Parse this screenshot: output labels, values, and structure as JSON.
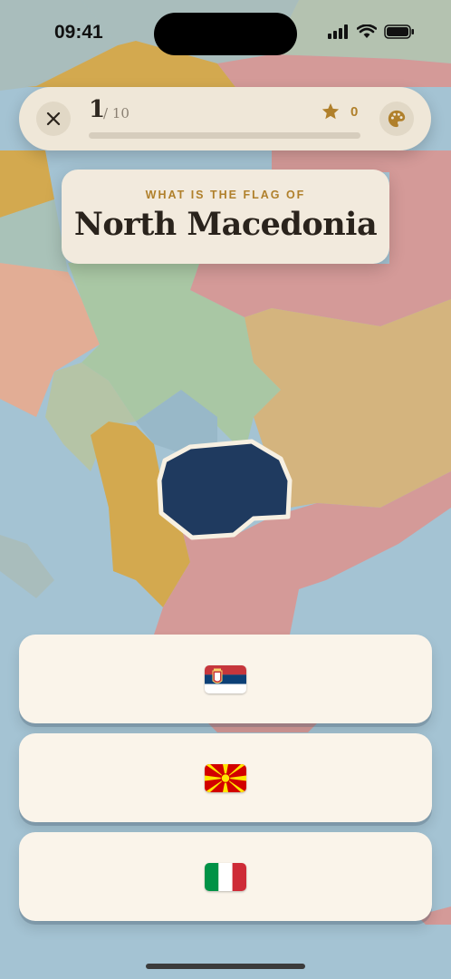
{
  "status_bar": {
    "time": "09:41"
  },
  "header": {
    "close_icon": "close-icon",
    "progress_current": "1",
    "progress_total": "/ 10",
    "progress_fraction": 0.0,
    "score": "0",
    "star_icon": "star-icon",
    "theme_icon": "palette-icon"
  },
  "question": {
    "prompt": "WHAT IS THE FLAG OF",
    "country": "North Macedonia"
  },
  "map": {
    "highlight_color": "#1f3a5f"
  },
  "answers": [
    {
      "flag": "Serbia flag",
      "flag_icon": "serbia-flag-icon"
    },
    {
      "flag": "North Macedonia flag",
      "flag_icon": "north-macedonia-flag-icon"
    },
    {
      "flag": "Italy flag",
      "flag_icon": "italy-flag-icon"
    }
  ]
}
